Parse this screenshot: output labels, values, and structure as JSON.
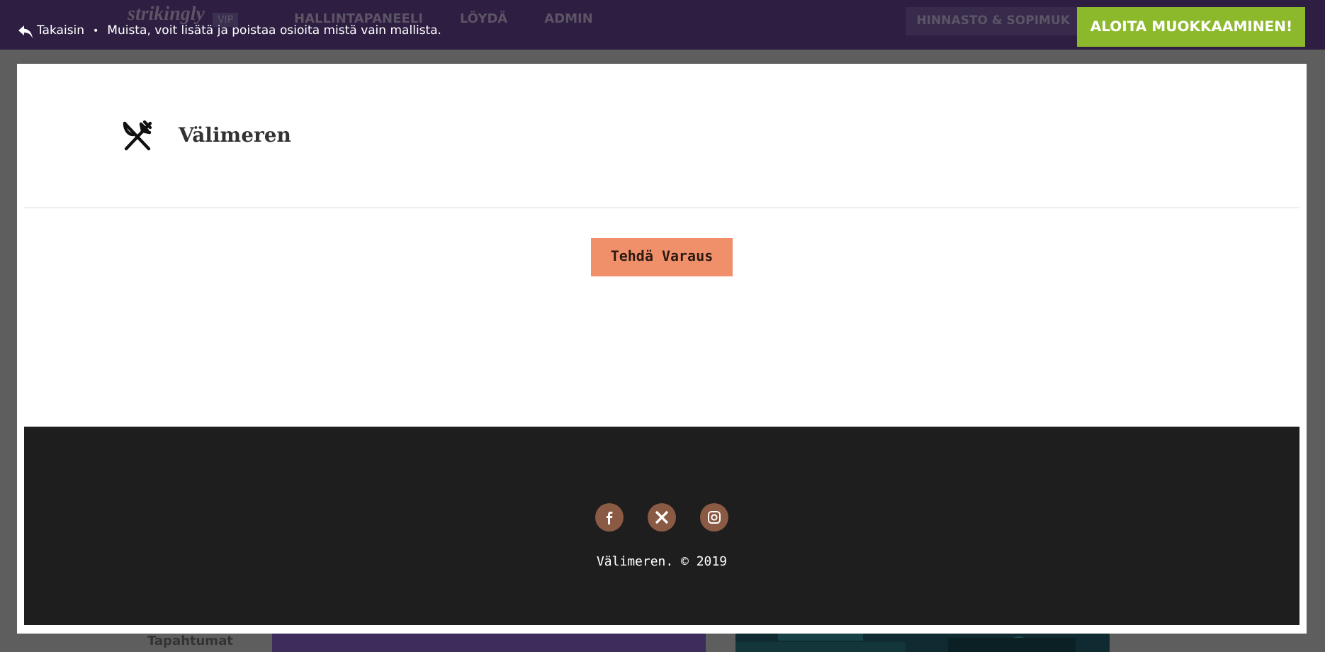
{
  "top_bar": {
    "logo": "strikingly",
    "badge": "VIP",
    "nav": [
      "HALLINTAPANEELI",
      "LÖYDÄ",
      "ADMIN"
    ],
    "pricing": "HINNASTO & SOPIMUK"
  },
  "hint_bar": {
    "back": "Takaisin",
    "separator": "•",
    "note": "Muista, voit lisätä ja poistaa osioita mistä vain mallista.",
    "action": "ALOITA MUOKKAAMINEN!"
  },
  "preview": {
    "title": "Välimeren",
    "button": "Tehdä Varaus",
    "footer": {
      "socials": [
        {
          "kind": "facebook"
        },
        {
          "kind": "x"
        },
        {
          "kind": "instagram"
        }
      ],
      "copyright": "Välimeren. © 2019"
    }
  },
  "background_page": {
    "sidebar_item": "Tapahtumat"
  }
}
